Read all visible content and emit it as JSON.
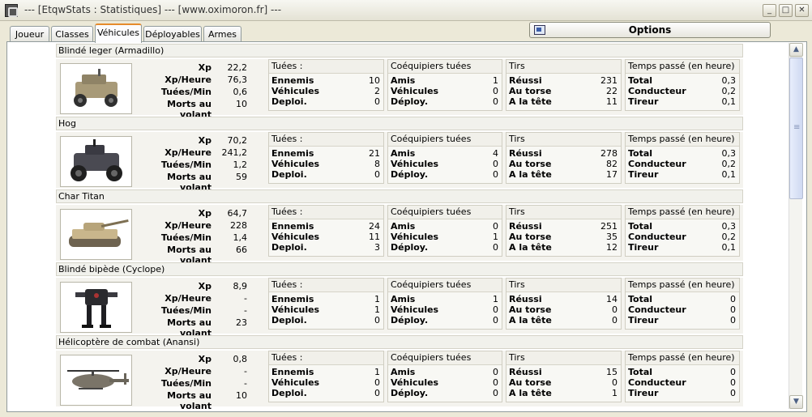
{
  "window": {
    "title": "--- [EtqwStats : Statistiques] --- [www.oximoron.fr] ---"
  },
  "tabs": [
    "Joueur",
    "Classes",
    "Véhicules",
    "Déployables",
    "Armes"
  ],
  "active_tab": "Véhicules",
  "options_label": "Options",
  "labels": {
    "xp": "Xp",
    "xp_heure": "Xp/Heure",
    "tuees_min": "Tuées/Min",
    "morts_volant": "Morts au volant",
    "kills_title": "Tuées :",
    "team_title": "Coéquipiers tuées",
    "shots_title": "Tirs",
    "time_title": "Temps passé (en heure)",
    "ennemis": "Ennemis",
    "vehicules": "Véhicules",
    "deploi": "Deploi.",
    "amis": "Amis",
    "deploy": "Déploy.",
    "reussi": "Réussi",
    "au_torse": "Au torse",
    "a_la_tete": "A la tête",
    "total": "Total",
    "conducteur": "Conducteur",
    "tireur": "Tireur"
  },
  "vehicles": [
    {
      "name": "Blindé leger (Armadillo)",
      "image": "armadillo-image",
      "xp": "22,2",
      "xp_heure": "76,3",
      "tuees_min": "0,6",
      "morts_volant": "10",
      "kills": [
        "10",
        "2",
        "0"
      ],
      "team": [
        "1",
        "0",
        "0"
      ],
      "shots": [
        "231",
        "22",
        "11"
      ],
      "time": [
        "0,3",
        "0,2",
        "0,1"
      ]
    },
    {
      "name": "Hog",
      "image": "hog-image",
      "xp": "70,2",
      "xp_heure": "241,2",
      "tuees_min": "1,2",
      "morts_volant": "59",
      "kills": [
        "21",
        "8",
        "0"
      ],
      "team": [
        "4",
        "0",
        "0"
      ],
      "shots": [
        "278",
        "82",
        "17"
      ],
      "time": [
        "0,3",
        "0,2",
        "0,1"
      ]
    },
    {
      "name": "Char Titan",
      "image": "titan-tank-image",
      "xp": "64,7",
      "xp_heure": "228",
      "tuees_min": "1,4",
      "morts_volant": "66",
      "kills": [
        "24",
        "11",
        "3"
      ],
      "team": [
        "0",
        "1",
        "0"
      ],
      "shots": [
        "251",
        "35",
        "12"
      ],
      "time": [
        "0,3",
        "0,2",
        "0,1"
      ]
    },
    {
      "name": "Blindé bipède (Cyclope)",
      "image": "cyclops-walker-image",
      "xp": "8,9",
      "xp_heure": "-",
      "tuees_min": "-",
      "morts_volant": "23",
      "kills": [
        "1",
        "1",
        "0"
      ],
      "team": [
        "1",
        "0",
        "0"
      ],
      "shots": [
        "14",
        "0",
        "0"
      ],
      "time": [
        "0",
        "0",
        "0"
      ]
    },
    {
      "name": "Hélicoptère de combat (Anansi)",
      "image": "anansi-helicopter-image",
      "xp": "0,8",
      "xp_heure": "-",
      "tuees_min": "-",
      "morts_volant": "10",
      "kills": [
        "1",
        "0",
        "0"
      ],
      "team": [
        "0",
        "0",
        "0"
      ],
      "shots": [
        "15",
        "0",
        "1"
      ],
      "time": [
        "0",
        "0",
        "0"
      ]
    }
  ]
}
